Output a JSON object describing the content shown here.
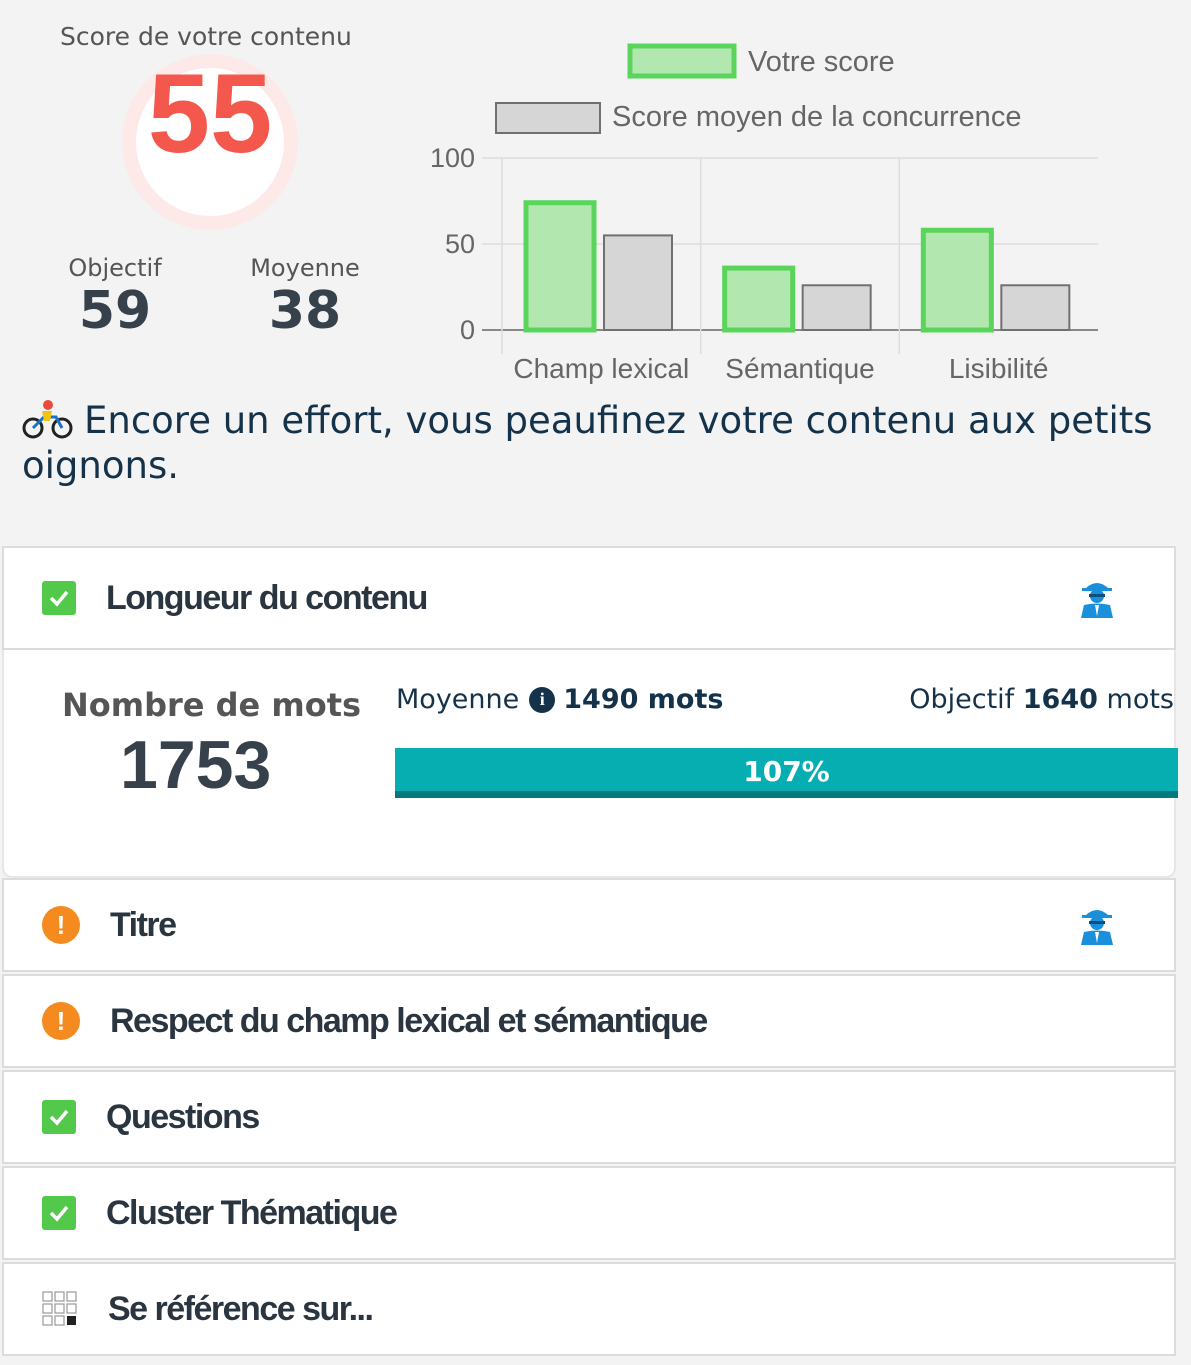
{
  "score": {
    "title": "Score de votre contenu",
    "value": "55",
    "objectif_label": "Objectif",
    "objectif_value": "59",
    "moyenne_label": "Moyenne",
    "moyenne_value": "38"
  },
  "chart_data": {
    "type": "bar",
    "categories": [
      "Champ lexical",
      "Sémantique",
      "Lisibilité"
    ],
    "series": [
      {
        "name": "Votre score",
        "values": [
          74,
          36,
          58
        ],
        "color": "#5bd45b",
        "fill": "#b2e8b0"
      },
      {
        "name": "Score moyen de la concurrence",
        "values": [
          55,
          26,
          26
        ],
        "color": "#707070",
        "fill": "#d6d6d6"
      }
    ],
    "yticks": [
      0,
      50,
      100
    ],
    "ylim": [
      0,
      100
    ],
    "grid": true,
    "legend": "top"
  },
  "message": "Encore un effort, vous peaufinez votre contenu aux petits oignons.",
  "sections": {
    "longueur": "Longueur du contenu",
    "titre": "Titre",
    "respect": "Respect du champ lexical et sémantique",
    "questions": "Questions",
    "cluster": "Cluster Thématique",
    "reference": "Se référence sur..."
  },
  "words": {
    "label": "Nombre de mots",
    "count": "1753",
    "avg_label": "Moyenne",
    "avg_value": "1490 mots",
    "obj_label": "Objectif",
    "obj_value": "1640",
    "obj_unit": "mots",
    "progress_text": "107%",
    "progress_percent": 107
  },
  "icons": {
    "check": "check-icon",
    "warning": "exclamation-icon",
    "spy": "spy-icon",
    "info": "info-icon",
    "grid": "grid-icon",
    "cyclist": "cyclist-emoji-icon"
  }
}
